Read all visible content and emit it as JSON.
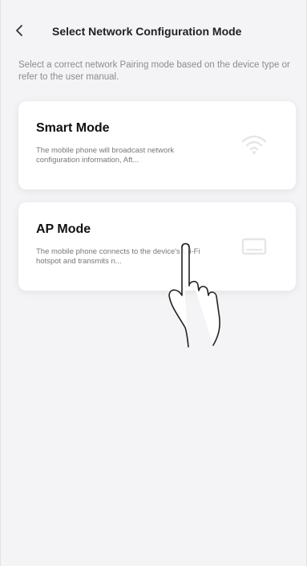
{
  "header": {
    "title": "Select Network Configuration Mode"
  },
  "description": "Select a correct network Pairing mode based on the device type or refer to the user manual.",
  "modes": [
    {
      "title": "Smart Mode",
      "description": "The mobile phone will broadcast network configuration information, Aft...",
      "icon": "wifi-icon"
    },
    {
      "title": "AP Mode",
      "description": "The mobile phone connects to the device's Wi-Fi hotspot and transmits n...",
      "icon": "router-icon"
    }
  ],
  "colors": {
    "background": "#f4f4f6",
    "card": "#ffffff",
    "title_text": "#222222",
    "muted_text": "#8c8c90"
  }
}
